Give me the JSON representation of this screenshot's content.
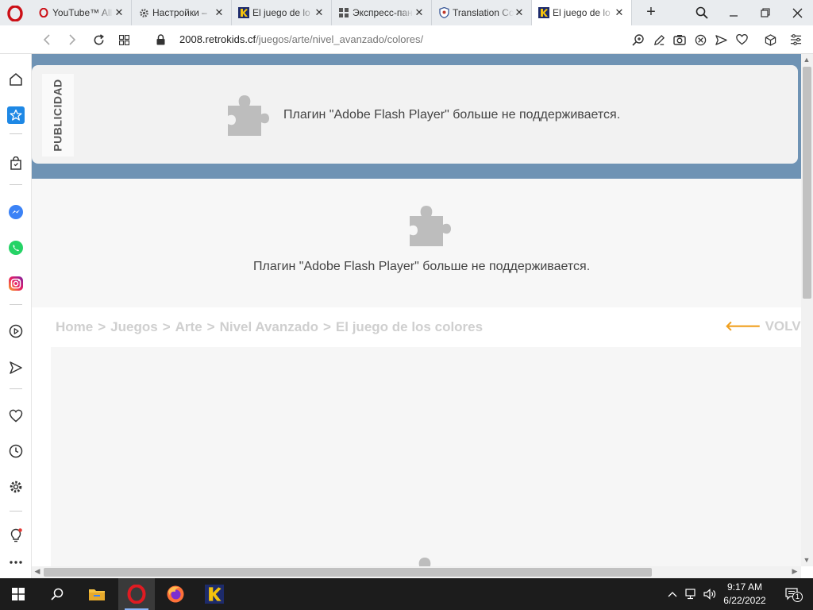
{
  "browser": {
    "tabs": [
      {
        "title": "YouTube™ All",
        "favicon": "opera-icon",
        "active": false
      },
      {
        "title": "Настройки –",
        "favicon": "gear-icon",
        "active": false
      },
      {
        "title": "El juego de lo",
        "favicon": "retrokids-icon",
        "active": false
      },
      {
        "title": "Экспресс-пан",
        "favicon": "grid-icon",
        "active": false
      },
      {
        "title": "Translation Co",
        "favicon": "shield-icon",
        "active": false
      },
      {
        "title": "El juego de lo",
        "favicon": "retrokids-icon",
        "active": true
      }
    ],
    "address": {
      "host": "2008.retrokids.cf",
      "path": "/juegos/arte/nivel_avanzado/colores/"
    }
  },
  "page": {
    "ad_label": "PUBLICIDAD",
    "plugin_message": "Плагин \"Adobe Flash Player\" больше не поддерживается.",
    "breadcrumb": [
      "Home",
      "Juegos",
      "Arte",
      "Nivel Avanzado",
      "El juego de los colores"
    ],
    "breadcrumb_separator": ">",
    "back_label": "VOLVER"
  },
  "taskbar": {
    "time": "9:17 AM",
    "date": "6/22/2022",
    "notification_count": "1"
  },
  "colors": {
    "ad_band": "#6f93b4",
    "opera_red": "#cc0f16",
    "back_arrow": "#f0a020"
  }
}
